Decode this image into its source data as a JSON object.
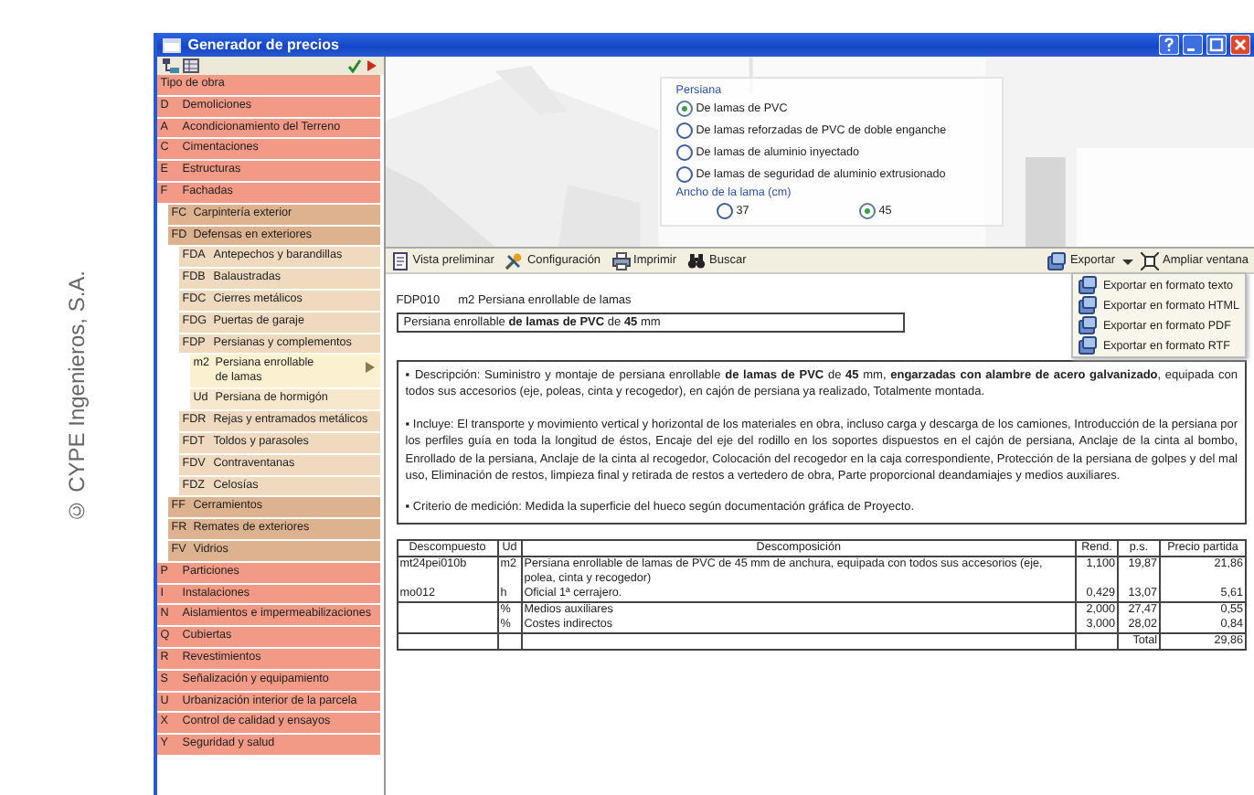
{
  "credit": "© CYPE Ingenieros, S.A.",
  "window": {
    "title": "Generador de precios"
  },
  "sidebar": {
    "tree": [
      {
        "label": "Tipo de obra",
        "selected": false
      },
      {
        "code": "D",
        "label": "Demoliciones",
        "selected": false
      },
      {
        "code": "A",
        "label": "Acondicionamiento del Terreno",
        "selected": false
      },
      {
        "code": "C",
        "label": "Cimentaciones",
        "selected": false
      },
      {
        "code": "E",
        "label": "Estructuras",
        "selected": false
      },
      {
        "code": "F",
        "label": "Fachadas",
        "selected": false,
        "children": [
          {
            "code": "FC",
            "label": "Carpintería exterior",
            "selected": false
          },
          {
            "code": "FD",
            "label": "Defensas en exteriores",
            "selected": false,
            "children": [
              {
                "code": "FDA",
                "label": "Antepechos y barandillas",
                "selected": false
              },
              {
                "code": "FDB",
                "label": "Balaustradas",
                "selected": false
              },
              {
                "code": "FDC",
                "label": "Cierres metálicos",
                "selected": false
              },
              {
                "code": "FDG",
                "label": "Puertas de garaje",
                "selected": false
              },
              {
                "code": "FDP",
                "label": "Persianas y complementos",
                "selected": false,
                "children": [
                  {
                    "code": "m2",
                    "label": "Persiana enrollable de lamas",
                    "selected": true
                  },
                  {
                    "code": "Ud",
                    "label": "Persiana de hormigón",
                    "selected": false
                  }
                ]
              },
              {
                "code": "FDR",
                "label": "Rejas y entramados metálicos",
                "selected": false
              },
              {
                "code": "FDT",
                "label": "Toldos y parasoles",
                "selected": false
              },
              {
                "code": "FDV",
                "label": "Contraventanas",
                "selected": false
              },
              {
                "code": "FDZ",
                "label": "Celosías",
                "selected": false
              }
            ]
          },
          {
            "code": "FF",
            "label": "Cerramientos",
            "selected": false
          },
          {
            "code": "FR",
            "label": "Remates de exteriores",
            "selected": false
          },
          {
            "code": "FV",
            "label": "Vidrios",
            "selected": false
          }
        ]
      },
      {
        "code": "P",
        "label": "Particiones",
        "selected": false
      },
      {
        "code": "I",
        "label": "Instalaciones",
        "selected": false
      },
      {
        "code": "N",
        "label": "Aislamientos e impermeabilizaciones",
        "selected": false
      },
      {
        "code": "Q",
        "label": "Cubiertas",
        "selected": false
      },
      {
        "code": "R",
        "label": "Revestimientos",
        "selected": false
      },
      {
        "code": "S",
        "label": "Señalización y equipamiento",
        "selected": false
      },
      {
        "code": "U",
        "label": "Urbanización interior de la parcela",
        "selected": false
      },
      {
        "code": "X",
        "label": "Control de calidad y ensayos",
        "selected": false
      },
      {
        "code": "Y",
        "label": "Seguridad y salud",
        "selected": false
      }
    ]
  },
  "options": {
    "groups": [
      {
        "title": "Persiana",
        "options": [
          {
            "label": "De lamas de PVC",
            "selected": true
          },
          {
            "label": "De lamas reforzadas de PVC de doble enganche",
            "selected": false
          },
          {
            "label": "De lamas de aluminio inyectado",
            "selected": false
          },
          {
            "label": "De lamas de seguridad de aluminio extrusionado",
            "selected": false
          }
        ]
      },
      {
        "title": "Ancho de la lama (cm)",
        "options": [
          {
            "label": "37",
            "selected": false
          },
          {
            "label": "45",
            "selected": true
          }
        ]
      }
    ]
  },
  "toolbar": {
    "left": [
      "Vista preliminar",
      "Configuración",
      "Imprimir",
      "Buscar"
    ],
    "right": [
      "Exportar",
      "Ampliar ventana"
    ]
  },
  "export_menu": [
    "Exportar en formato texto",
    "Exportar en formato HTML",
    "Exportar en formato PDF",
    "Exportar en formato RTF"
  ],
  "item": {
    "code": "FDP010",
    "unit_title": "m2 Persiana enrollable de lamas",
    "summary": "Persiana enrollable **de lamas de PVC** de **45** mm",
    "paragraphs": [
      "▪ Descripción: Suministro y montaje de persiana enrollable **de lamas de PVC** de **45** mm, **engarzadas con alambre de acero galvanizado**, equipada con todos sus accesorios (eje, poleas, cinta y recogedor), en cajón de persiana ya realizado, Totalmente montada.",
      "▪ Incluye: El transporte y movimiento vertical y horizontal de los materiales en obra, incluso carga y descarga de los camiones, Introducción de la persiana por los perfiles guía en toda la longitud de éstos, Encaje del eje del rodillo en los soportes dispuestos en el cajón de persiana, Anclaje de la cinta al bombo, Enrollado de la persiana, Anclaje de la cinta al recogedor, Colocación del recogedor en la caja correspondiente, Protección de la persiana de golpes y del mal uso, Eliminación de restos, limpieza final y retirada de restos a vertedero de obra, Parte proporcional deandamiajes y medios auxiliares.",
      "▪ Criterio de medición: Medida la superficie del hueco según documentación gráfica de Proyecto."
    ]
  },
  "table": {
    "columns": [
      "Descompuesto",
      "Ud",
      "Descomposición",
      "Rend.",
      "p.s.",
      "Precio partida"
    ],
    "rows": [
      [
        "mt24pei010b",
        "m2",
        "Persiana enrollable de lamas de PVC de 45 mm de anchura, equipada con todos sus accesorios (eje, polea, cinta y recogedor)",
        "1,100",
        "19,87",
        "21,86"
      ],
      [
        "mo012",
        "h",
        "Oficial 1ª cerrajero.",
        "0,429",
        "13,07",
        "5,61"
      ],
      [
        null,
        "%",
        "Medios auxiliares",
        "2,000",
        "27,47",
        "0,55"
      ],
      [
        null,
        "%",
        "Costes indirectos",
        "3,000",
        "28,02",
        "0,84"
      ],
      [
        null,
        null,
        null,
        null,
        "Total",
        "29,86"
      ]
    ]
  }
}
